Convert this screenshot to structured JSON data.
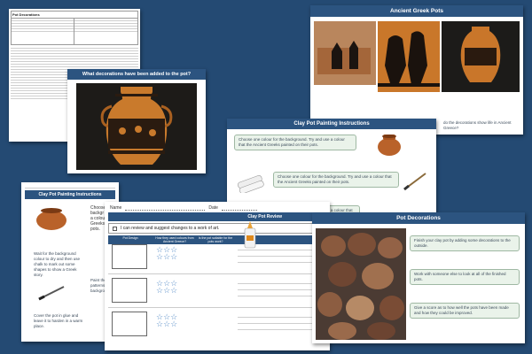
{
  "colors": {
    "background": "#244a73",
    "header_blue": "#2c5480",
    "bubble_green": "#eaf3ea"
  },
  "sheet_pot_decorations_doc": {
    "title": "Pot Decorations"
  },
  "sheet_added_decorations": {
    "title": "What decorations have been added to the pot?"
  },
  "sheet_greek_pots": {
    "title": "Ancient Greek Pots",
    "caption": "do the decorations show life in Ancient Greece?"
  },
  "sheet_painting_instructions_slide": {
    "title": "Clay Pot Painting Instructions",
    "steps": [
      "Choose one colour for the background. Try and use a colour that the Ancient Greeks painted on their pots.",
      "Choose one colour for the background. Try and use a colour that the Ancient Greeks painted on their pots.",
      "Choose one colour for the background. Try and use a colour that the Ancient Greeks painted on their pots."
    ]
  },
  "sheet_painting_instructions_doc": {
    "title": "Clay Pot Painting Instructions",
    "steps": [
      "Wait for the background colour to dry and then use chalk to mark out some shapes to show a Greek story.",
      "Paint the patterns background.",
      "Cover the pot in glue and leave it to harden in a warm place."
    ],
    "side_text": [
      "Choose",
      "backgr",
      "a colour",
      "Greeks p",
      "pots."
    ]
  },
  "sheet_review": {
    "title": "Clay Pot Review",
    "objective": "I can review and suggest changes to a work of art.",
    "name_label": "Name",
    "date_label": "Date",
    "columns": [
      "Pot Design",
      "How they used colours from Ancient Greece?",
      "Is the pot suitable for the pots work?"
    ]
  },
  "sheet_pot_decorations_slide": {
    "title": "Pot Decorations",
    "steps": [
      "Finish your clay pot by adding some decorations to the outside.",
      "Work with someone else to look at all of the finished pots.",
      "Give a score as to how well the pots have been made and how they could be improved."
    ]
  }
}
